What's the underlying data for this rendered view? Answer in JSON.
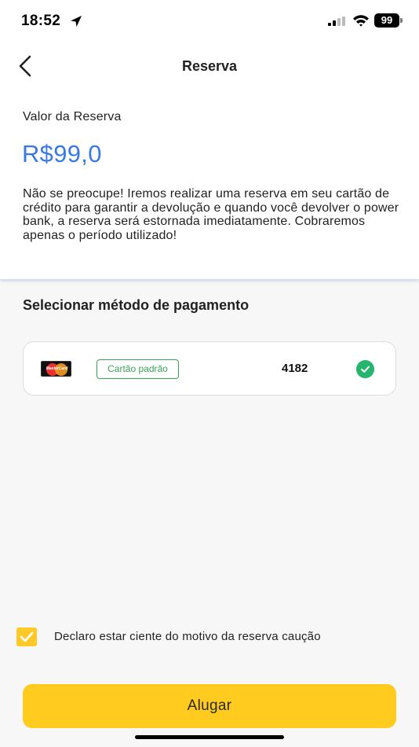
{
  "status_bar": {
    "time": "18:52",
    "battery": "99",
    "icons": [
      "location-arrow-icon",
      "signal-icon",
      "wifi-icon",
      "battery-icon"
    ]
  },
  "nav": {
    "title": "Reserva",
    "back_icon": "chevron-left-icon"
  },
  "reservation": {
    "label": "Valor da Reserva",
    "amount": "R$99,0",
    "notice": "Não se preocupe! Iremos realizar uma reserva em seu cartão de crédito para garantir a devolução e quando você devolver o power bank, a reserva será estornada imediatamente. Cobraremos apenas o período utilizado!"
  },
  "payment": {
    "heading": "Selecionar método de pagamento",
    "card": {
      "brand_icon": "mastercard-icon",
      "brand_text": "MasterCard",
      "badge": "Cartão padrão",
      "last_digits": "4182",
      "selected": true
    }
  },
  "consent": {
    "checked": true,
    "text": "Declaro estar ciente do motivo da reserva caução"
  },
  "action": {
    "label": "Alugar"
  },
  "colors": {
    "accent_yellow": "#ffcb1f",
    "amount_blue": "#3a7ae0",
    "success_green": "#27b56e"
  }
}
